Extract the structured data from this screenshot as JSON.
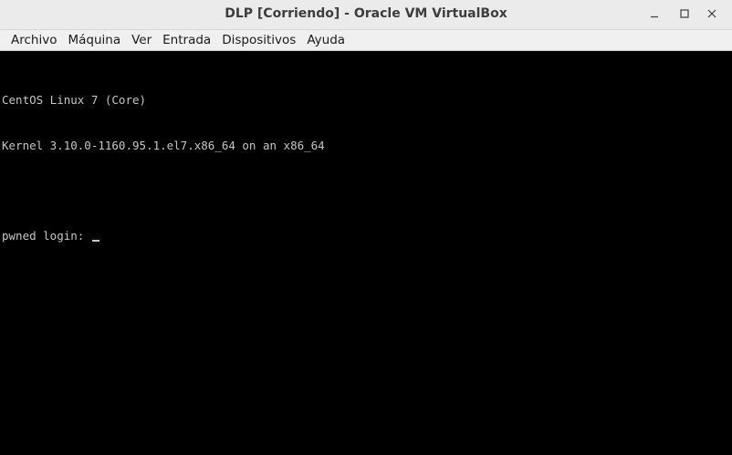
{
  "window": {
    "title": "DLP [Corriendo] - Oracle VM VirtualBox"
  },
  "window_controls": {
    "minimize_icon": "minimize-icon",
    "maximize_icon": "maximize-icon",
    "close_icon": "close-icon"
  },
  "menubar": {
    "items": [
      "Archivo",
      "Máquina",
      "Ver",
      "Entrada",
      "Dispositivos",
      "Ayuda"
    ]
  },
  "console": {
    "lines": [
      "CentOS Linux 7 (Core)",
      "Kernel 3.10.0-1160.95.1.el7.x86_64 on an x86_64",
      "",
      "pwned login: "
    ]
  },
  "colors": {
    "console_background": "#000000",
    "console_text": "#c6c6c6",
    "titlebar": "#ebebeb",
    "menubar": "#f0f0f0"
  }
}
